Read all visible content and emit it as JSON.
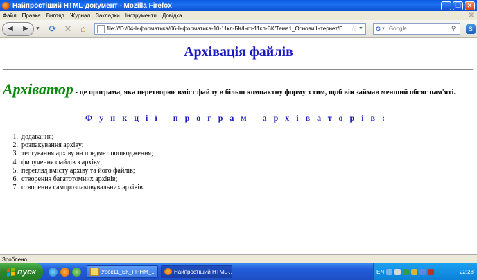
{
  "window": {
    "title": "Найпростіший HTML-документ - Mozilla Firefox"
  },
  "menu": [
    "Файл",
    "Правка",
    "Вигляд",
    "Журнал",
    "Закладки",
    "Інструменти",
    "Довідка"
  ],
  "nav": {
    "url": "file:///D:/04-Інформатика/06-Інформатика-10-11кл-БК/Інф-11кл-БК/Тема1_Основи Інтернет/Підтем",
    "search_placeholder": "Google",
    "search_engine": "G"
  },
  "page": {
    "title": "Архівація файлів",
    "term": "Архіватор",
    "definition": " - це програма, яка перетворює вміст файлу в більш компактну форму з тим, щоб він займав менший обсяг пам'яті.",
    "functions_heading": "Функції програм архіваторів:",
    "functions": [
      {
        "num": "1.",
        "text": "додавання;"
      },
      {
        "num": "2.",
        "text": "розпакування архіву;"
      },
      {
        "num": "3.",
        "text": "тестування архіву на предмет пошкодження;"
      },
      {
        "num": "4.",
        "text": "филучення файлів з архіву;"
      },
      {
        "num": "5.",
        "text": "перегляд вмісту архіву та його файлів;"
      },
      {
        "num": "6.",
        "text": "створення багатотомних архівів;"
      },
      {
        "num": "7.",
        "text": "створення саморозпаковувальних архівів."
      }
    ]
  },
  "status": {
    "text": "Зроблено"
  },
  "taskbar": {
    "start": "пуск",
    "tasks": [
      "Урок11_БК_ПРНМ_...",
      "Найпростіший HTML-..."
    ],
    "lang": "EN",
    "clock": "22:28"
  },
  "colors": {
    "heading": "#1a1ac0",
    "term": "#0a8a0a",
    "titlebar": "#0a5ce0",
    "taskbar": "#245edb"
  }
}
